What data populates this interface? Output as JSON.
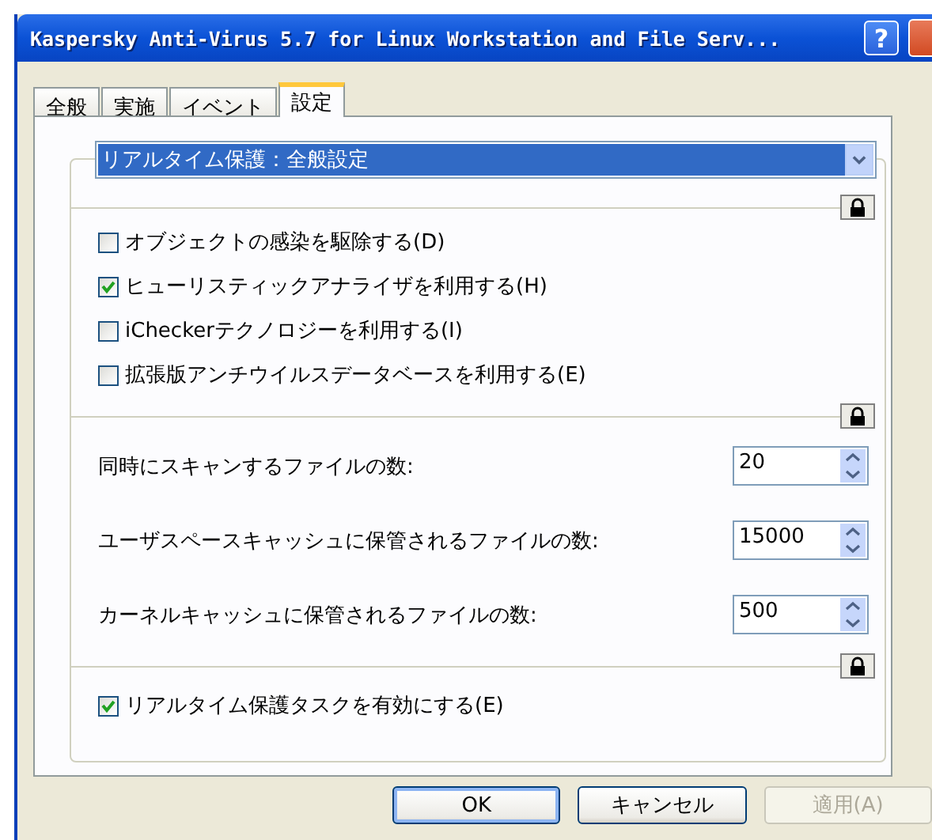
{
  "window": {
    "title": "Kaspersky Anti-Virus 5.7 for Linux Workstation and File Serv...",
    "help_button": "?"
  },
  "tabs": [
    {
      "label": "全般",
      "selected": false
    },
    {
      "label": "実施",
      "selected": false
    },
    {
      "label": "イベント",
      "selected": false
    },
    {
      "label": "設定",
      "selected": true
    }
  ],
  "section_dropdown": {
    "value": "リアルタイム保護：全般設定"
  },
  "options": [
    {
      "label": "オブジェクトの感染を駆除する(D)",
      "checked": false
    },
    {
      "label": "ヒューリスティックアナライザを利用する(H)",
      "checked": true
    },
    {
      "label": "iCheckerテクノロジーを利用する(I)",
      "checked": false
    },
    {
      "label": "拡張版アンチウイルスデータベースを利用する(E)",
      "checked": false
    }
  ],
  "limits": [
    {
      "label": "同時にスキャンするファイルの数:",
      "value": "20"
    },
    {
      "label": "ユーザスペースキャッシュに保管されるファイルの数:",
      "value": "15000"
    },
    {
      "label": "カーネルキャッシュに保管されるファイルの数:",
      "value": "500"
    }
  ],
  "enable_task": {
    "label": "リアルタイム保護タスクを有効にする(E)",
    "checked": true
  },
  "buttons": [
    {
      "label": "OK",
      "disabled": false
    },
    {
      "label": "キャンセル",
      "disabled": false
    },
    {
      "label": "適用(A)",
      "disabled": true
    }
  ]
}
